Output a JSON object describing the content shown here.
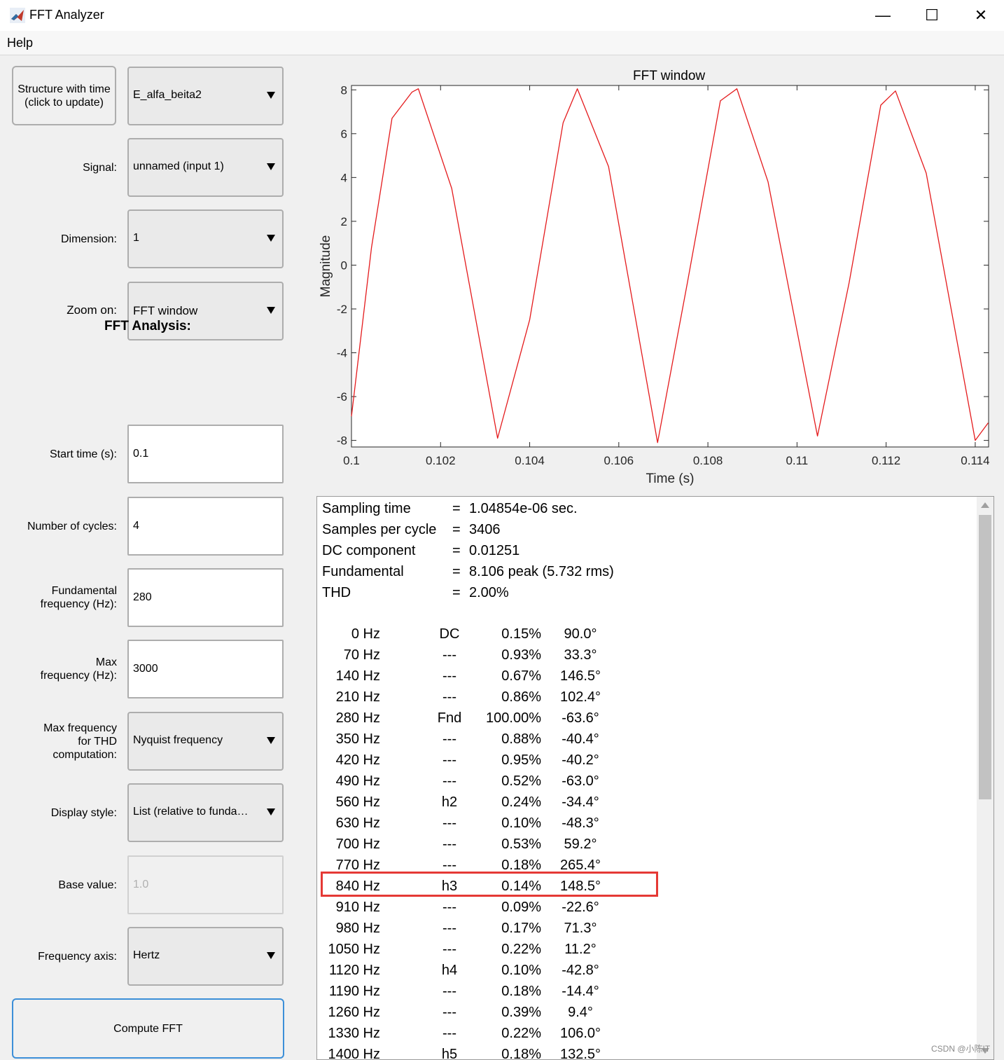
{
  "window": {
    "title": "FFT Analyzer",
    "controls": {
      "minimize": "—",
      "maximize": "☐",
      "close": "✕"
    }
  },
  "menu": {
    "help": "Help"
  },
  "controls": {
    "structure_button": "Structure with time\n(click to update)",
    "structure_value": "E_alfa_beita2",
    "signal_label": "Signal:",
    "signal_value": "unnamed (input 1)",
    "dimension_label": "Dimension:",
    "dimension_value": "1",
    "zoom_label": "Zoom on:",
    "zoom_value": "FFT window",
    "fft_title": "FFT Analysis:",
    "start_time_label": "Start time (s):",
    "start_time_value": "0.1",
    "cycles_label": "Number of cycles:",
    "cycles_value": "4",
    "fund_freq_label": "Fundamental\nfrequency (Hz):",
    "fund_freq_value": "280",
    "max_freq_label": "Max\nfrequency (Hz):",
    "max_freq_value": "3000",
    "thd_freq_label": "Max frequency\nfor THD\ncomputation:",
    "thd_freq_value": "Nyquist frequency",
    "display_label": "Display style:",
    "display_value": "List (relative to funda…",
    "base_label": "Base value:",
    "base_value": "1.0",
    "freq_axis_label": "Frequency axis:",
    "freq_axis_value": "Hertz",
    "compute_button": "Compute FFT"
  },
  "chart_data": {
    "type": "line",
    "title": "FFT window",
    "xlabel": "Time (s)",
    "ylabel": "Magnitude",
    "xlim": [
      0.1,
      0.1143
    ],
    "ylim": [
      -8.3,
      8.2
    ],
    "xticks": [
      "0.1",
      "0.102",
      "0.104",
      "0.106",
      "0.108",
      "0.11",
      "0.112",
      "0.114"
    ],
    "yticks": [
      "8",
      "6",
      "4",
      "2",
      "0",
      "-2",
      "-4",
      "-6",
      "-8"
    ],
    "series": [
      {
        "color": "#e41a1c",
        "x": [
          0.1,
          0.10045,
          0.10091,
          0.10136,
          0.1015,
          0.10225,
          0.10328,
          0.104,
          0.10475,
          0.10507,
          0.10577,
          0.10687,
          0.10754,
          0.10828,
          0.10865,
          0.10935,
          0.11046,
          0.11117,
          0.11188,
          0.11221,
          0.1129,
          0.114,
          0.11429
        ],
        "y": [
          -6.9,
          0.8,
          6.7,
          7.9,
          8.05,
          3.5,
          -7.9,
          -2.5,
          6.5,
          8.05,
          4.5,
          -8.1,
          -0.8,
          7.5,
          8.05,
          3.8,
          -7.8,
          -0.8,
          7.3,
          7.95,
          4.2,
          -8.0,
          -7.2
        ]
      }
    ]
  },
  "results": {
    "info": [
      {
        "k": "Sampling time",
        "eq": "=",
        "v": "1.04854e-06 sec."
      },
      {
        "k": "Samples per cycle",
        "eq": "=",
        "v": "3406"
      },
      {
        "k": "DC component",
        "eq": "=",
        "v": "0.01251"
      },
      {
        "k": "Fundamental",
        "eq": "=",
        "v": "8.106 peak (5.732 rms)"
      },
      {
        "k": "THD",
        "eq": "=",
        "v": "2.00%"
      }
    ],
    "rows": [
      {
        "f": "0 Hz",
        "tag": "DC",
        "pct": "0.15%",
        "ph": "90.0°"
      },
      {
        "f": "70 Hz",
        "tag": "---",
        "pct": "0.93%",
        "ph": "33.3°"
      },
      {
        "f": "140 Hz",
        "tag": "---",
        "pct": "0.67%",
        "ph": "146.5°"
      },
      {
        "f": "210 Hz",
        "tag": "---",
        "pct": "0.86%",
        "ph": "102.4°"
      },
      {
        "f": "280 Hz",
        "tag": "Fnd",
        "pct": "100.00%",
        "ph": "-63.6°"
      },
      {
        "f": "350 Hz",
        "tag": "---",
        "pct": "0.88%",
        "ph": "-40.4°"
      },
      {
        "f": "420 Hz",
        "tag": "---",
        "pct": "0.95%",
        "ph": "-40.2°"
      },
      {
        "f": "490 Hz",
        "tag": "---",
        "pct": "0.52%",
        "ph": "-63.0°"
      },
      {
        "f": "560 Hz",
        "tag": "h2",
        "pct": "0.24%",
        "ph": "-34.4°"
      },
      {
        "f": "630 Hz",
        "tag": "---",
        "pct": "0.10%",
        "ph": "-48.3°"
      },
      {
        "f": "700 Hz",
        "tag": "---",
        "pct": "0.53%",
        "ph": "59.2°"
      },
      {
        "f": "770 Hz",
        "tag": "---",
        "pct": "0.18%",
        "ph": "265.4°"
      },
      {
        "f": "840 Hz",
        "tag": "h3",
        "pct": "0.14%",
        "ph": "148.5°"
      },
      {
        "f": "910 Hz",
        "tag": "---",
        "pct": "0.09%",
        "ph": "-22.6°"
      },
      {
        "f": "980 Hz",
        "tag": "---",
        "pct": "0.17%",
        "ph": "71.3°"
      },
      {
        "f": "1050 Hz",
        "tag": "---",
        "pct": "0.22%",
        "ph": "11.2°"
      },
      {
        "f": "1120 Hz",
        "tag": "h4",
        "pct": "0.10%",
        "ph": "-42.8°"
      },
      {
        "f": "1190 Hz",
        "tag": "---",
        "pct": "0.18%",
        "ph": "-14.4°"
      },
      {
        "f": "1260 Hz",
        "tag": "---",
        "pct": "0.39%",
        "ph": "9.4°"
      },
      {
        "f": "1330 Hz",
        "tag": "---",
        "pct": "0.22%",
        "ph": "106.0°"
      },
      {
        "f": "1400 Hz",
        "tag": "h5",
        "pct": "0.18%",
        "ph": "132.5°"
      }
    ]
  },
  "watermark": "CSDN @小陈IT",
  "colors": {
    "highlight": "#e53935",
    "trace": "#e41a1c"
  }
}
